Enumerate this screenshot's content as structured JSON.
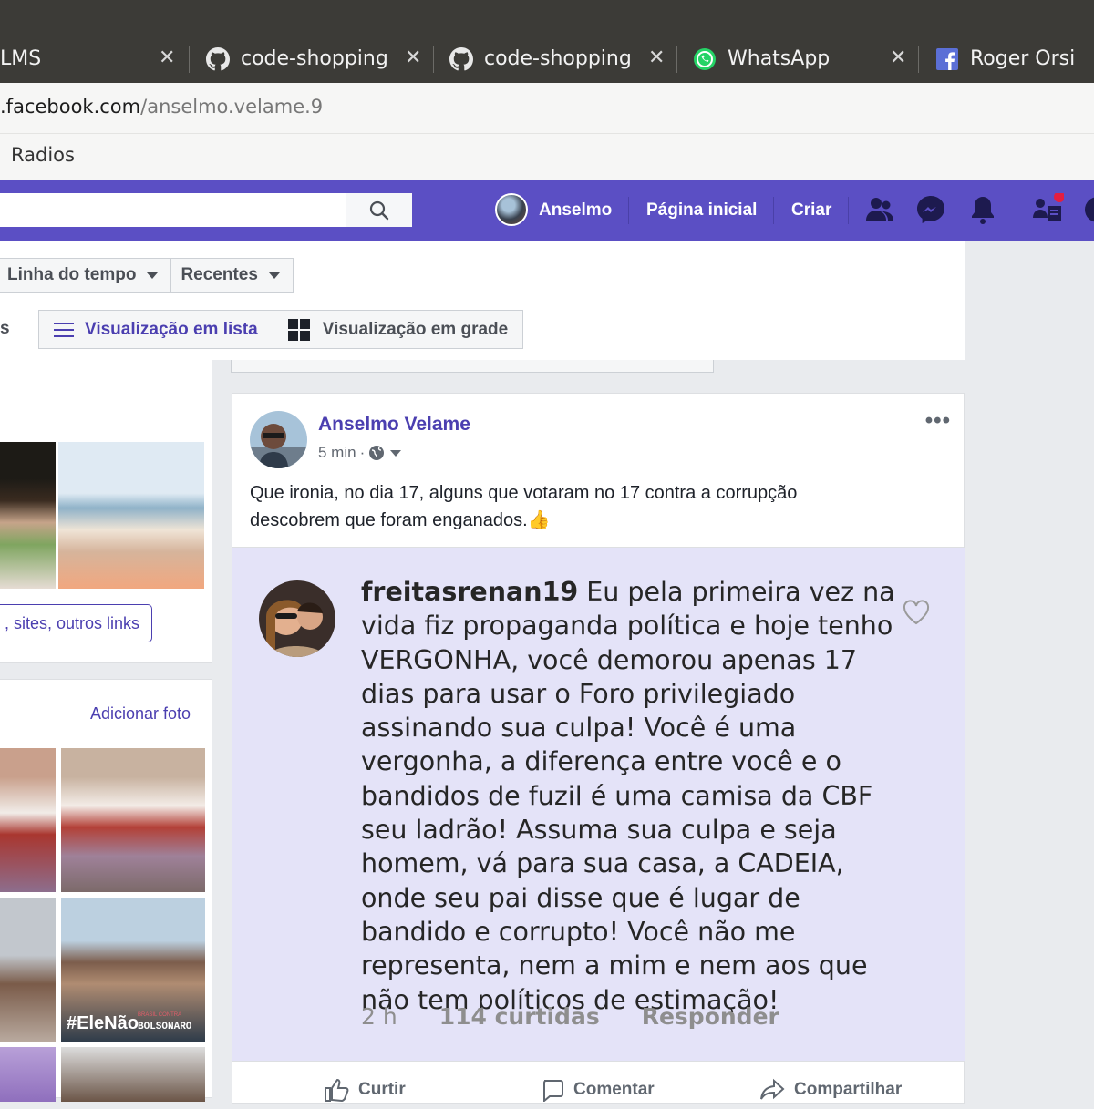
{
  "browser": {
    "tabs": [
      {
        "label": "LMS",
        "icon": "none"
      },
      {
        "label": "code-shopping/",
        "icon": "github-icon"
      },
      {
        "label": "code-shopping/",
        "icon": "github-icon"
      },
      {
        "label": "WhatsApp",
        "icon": "whatsapp-icon"
      },
      {
        "label": "Roger Orsi",
        "icon": "facebook-icon"
      }
    ],
    "url_domain": ".facebook.com",
    "url_path": "/anselmo.velame.9",
    "bookmark": "Radios"
  },
  "nav": {
    "user_name": "Anselmo",
    "home": "Página inicial",
    "create": "Criar",
    "color": "#5b4fc4"
  },
  "profile": {
    "timeline_dropdown": "Linha do tempo",
    "recent_dropdown": "Recentes",
    "partial_tab": "s",
    "list_view": "Visualização em lista",
    "grid_view": "Visualização em grade",
    "links_button": ", sites, outros links",
    "add_photo": "Adicionar foto",
    "photo_badge_left": "#EleNão",
    "photo_badge_right": "BOLSONARO",
    "photo_badge_small": "BRASIL CONTRA"
  },
  "post": {
    "author": "Anselmo Velame",
    "time": "5 min",
    "text": "Que ironia, no dia 17, alguns que votaram no 17 contra a corrupção descobrem que foram enganados.👍",
    "comment": {
      "username": "freitasrenan19",
      "text": " Eu pela primeira vez na vida fiz propaganda política e hoje tenho VERGONHA,  você demorou apenas 17 dias para usar o Foro privilegiado assinando sua culpa! Você é uma vergonha, a diferença entre você e o bandidos de fuzil é uma camisa da CBF seu ladrão! Assuma sua culpa e seja homem, vá para sua casa, a CADEIA, onde seu pai disse que é lugar de bandido e corrupto! Você não me representa, nem a mim e nem aos que não tem políticos de estimação!",
      "time": "2 h",
      "likes": "114 curtidas",
      "reply": "Responder"
    },
    "actions": {
      "like": "Curtir",
      "comment": "Comentar",
      "share": "Compartilhar"
    }
  }
}
